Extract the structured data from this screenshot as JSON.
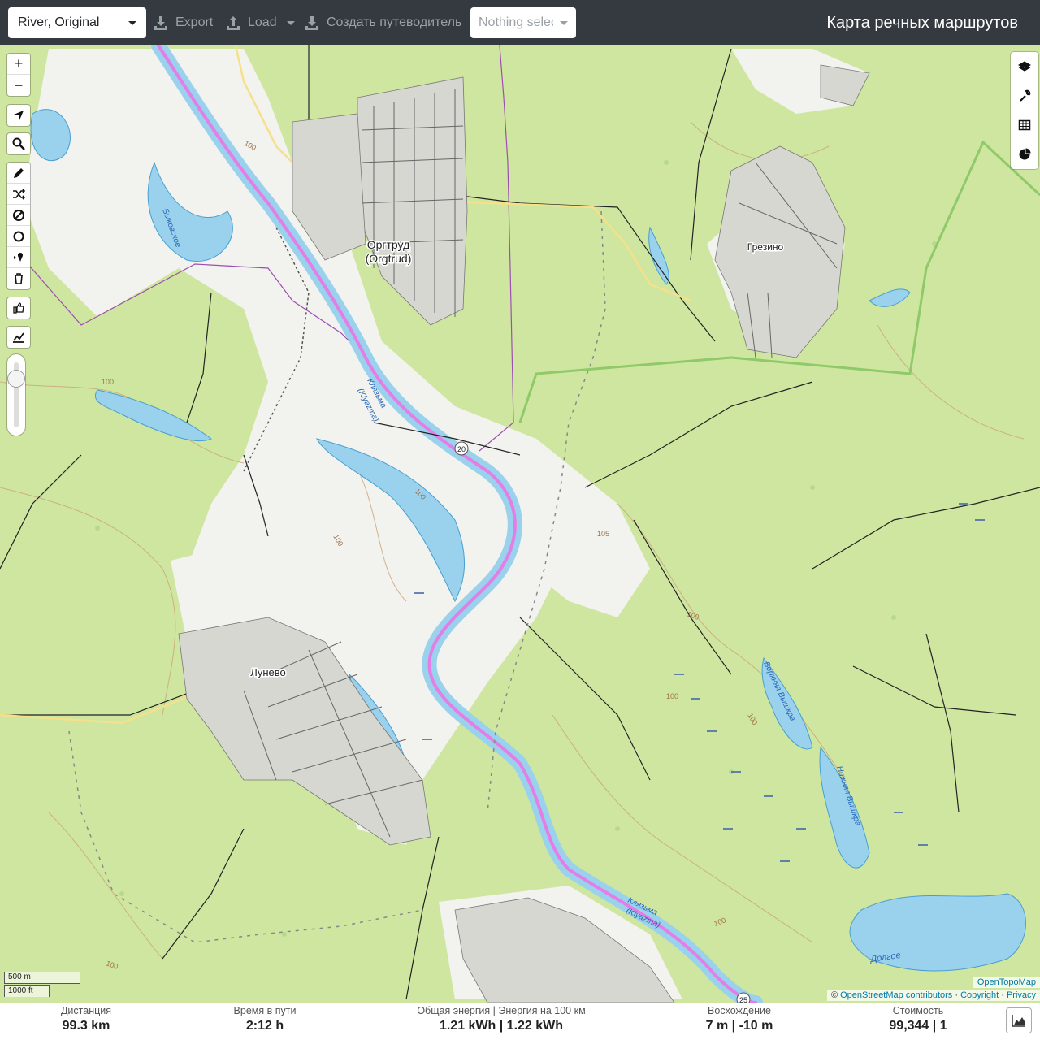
{
  "header": {
    "profile": "River, Original",
    "export_label": "Export",
    "load_label": "Load",
    "guide_label": "Создать путеводитель",
    "selection_label": "Nothing selected",
    "app_title": "Карта речных маршрутов"
  },
  "map": {
    "places": {
      "orgtrud": "Оргтруд",
      "orgtrud_latin": "(Orgtrud)",
      "grezino": "Грезино",
      "lunevo": "Лунево",
      "klyazma_1": "Клязьма",
      "klyazma_1_latin": "(Klyazma)",
      "klyazma_2": "Клязьма",
      "klyazma_2_latin": "(Klyazma)",
      "bykovskoe": "Быковское",
      "verkhnyaya_vyshkhra": "Верхняя Вышкра",
      "nizhnyaya_vyshkhra": "Нижняя Вышкра",
      "dolgoe": "Долгое",
      "road_20": "20",
      "road_25": "25"
    },
    "contour_labels": [
      "100",
      "100",
      "100",
      "100",
      "100",
      "100",
      "105",
      "100",
      "100",
      "100"
    ],
    "colors": {
      "forest": "#cfe6a0",
      "open": "#f2f2ee",
      "water": "#9ad1ec",
      "route": "#e47de6",
      "boundary": "#9c4fb0"
    }
  },
  "left_toolbar": {
    "zoom_in": "+",
    "zoom_out": "−",
    "icons": [
      "locate-icon",
      "search-icon",
      "draw-icon",
      "shuffle-icon",
      "no-entry-icon",
      "circle-icon",
      "poi-icon",
      "trash-icon",
      "thumb-icon",
      "elevation-icon"
    ]
  },
  "right_toolbar": {
    "icons": [
      "layers-icon",
      "wrench-icon",
      "table-icon",
      "pie-chart-icon"
    ]
  },
  "scale": {
    "metric": "500 m",
    "imperial": "1000 ft"
  },
  "attribution": {
    "tile_provider": "OpenTopoMap",
    "prefix": "© ",
    "osm": "OpenStreetMap contributors",
    "sep1": " · ",
    "copyright": "Copyright",
    "sep2": " · ",
    "privacy": "Privacy"
  },
  "stats": {
    "distance": {
      "label": "Дистанция",
      "value": "99.3 km"
    },
    "time": {
      "label": "Время в пути",
      "value": "2:12 h"
    },
    "energy": {
      "label": "Общая энергия | Энергия на 100 км",
      "value": "1.21 kWh | 1.22 kWh"
    },
    "ascent": {
      "label": "Восхождение",
      "value": "7 m | -10 m"
    },
    "cost": {
      "label": "Стоимость",
      "value": "99,344 | 1"
    }
  }
}
